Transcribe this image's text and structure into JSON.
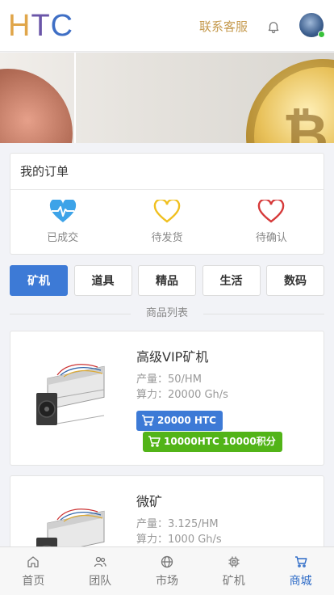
{
  "header": {
    "logo": {
      "h": "H",
      "t": "T",
      "c": "C"
    },
    "service_link": "联系客服",
    "bell_icon": "bell-icon",
    "avatar_icon": "avatar"
  },
  "orders": {
    "title": "我的订单",
    "items": [
      {
        "label": "已成交",
        "icon": "heartbeat-icon",
        "color": "#3da3e8"
      },
      {
        "label": "待发货",
        "icon": "heart-outline-icon",
        "color": "#f0c020"
      },
      {
        "label": "待确认",
        "icon": "heart-outline-icon",
        "color": "#d63a3a"
      }
    ]
  },
  "tabs": [
    "矿机",
    "道具",
    "精品",
    "生活",
    "数码"
  ],
  "active_tab": "矿机",
  "product_list_title": "商品列表",
  "products": [
    {
      "name": "高级VIP矿机",
      "output": "产量：50/HM",
      "hashrate": "算力：20000 Gh/s",
      "price_button": "20000 HTC",
      "points_button": "10000HTC 10000积分"
    },
    {
      "name": "微矿",
      "output": "产量：3.125/HM",
      "hashrate": "算力：1000 Gh/s"
    }
  ],
  "bottom_nav": [
    {
      "label": "首页",
      "icon": "home-icon"
    },
    {
      "label": "团队",
      "icon": "team-icon"
    },
    {
      "label": "市场",
      "icon": "globe-icon"
    },
    {
      "label": "矿机",
      "icon": "miner-icon"
    },
    {
      "label": "商城",
      "icon": "cart-icon"
    }
  ],
  "active_nav": "商城",
  "colors": {
    "primary": "#3d7ad6",
    "green": "#52b418",
    "gold": "#c59a4e"
  }
}
